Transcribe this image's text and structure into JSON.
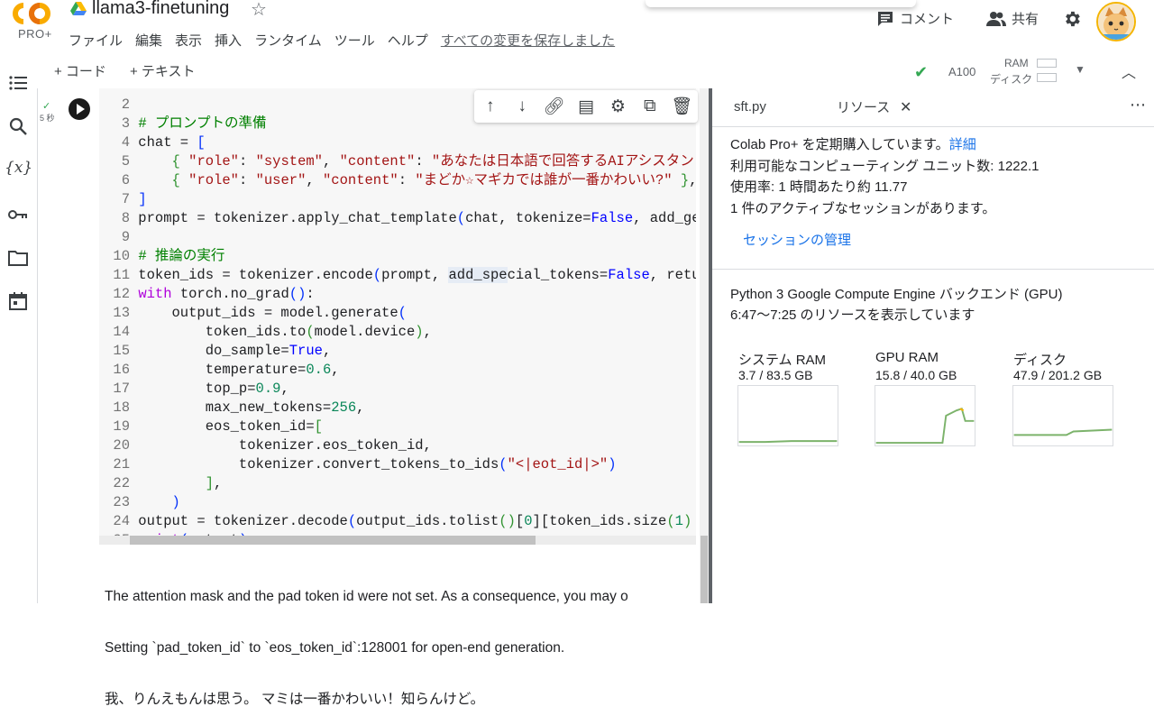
{
  "header": {
    "logo_sub": "PRO+",
    "title": "llama3-finetuning",
    "menu": [
      "ファイル",
      "編集",
      "表示",
      "挿入",
      "ランタイム",
      "ツール",
      "ヘルプ"
    ],
    "saved_status": "すべての変更を保存しました",
    "comment_label": "コメント",
    "share_label": "共有"
  },
  "toolbar": {
    "add_code": "+ コード",
    "add_text": "+ テキスト",
    "gpu": "A100",
    "ram_label": "RAM",
    "disk_label": "ディスク"
  },
  "cell": {
    "exec_time": "5 秒",
    "output_lines": [
      "The attention mask and the pad token id were not set. As a consequence, you may o",
      "Setting `pad_token_id` to `eos_token_id`:128001 for open-end generation.",
      "我、りんえもんは思う。 マミは一番かわいい！知らんけど。"
    ]
  },
  "panel": {
    "tab_file": "sft.py",
    "tab_resources": "リソース",
    "line1_prefix": "Colab Pro+ を定期購入しています。",
    "details_link": "詳細",
    "line2": "利用可能なコンピューティング ユニット数: 1222.1",
    "line3": "使用率: 1 時間あたり約 11.77",
    "line4": "1 件のアクティブなセッションがあります。",
    "manage_link": "セッションの管理",
    "backend": "Python 3 Google Compute Engine バックエンド (GPU)",
    "range": "6:47〜7:25 のリソースを表示しています",
    "resources": [
      {
        "title": "システム RAM",
        "value": "3.7 / 83.5 GB"
      },
      {
        "title": "GPU RAM",
        "value": "15.8 / 40.0 GB"
      },
      {
        "title": "ディスク",
        "value": "47.9 / 201.2 GB"
      }
    ]
  },
  "colors": {
    "accent_green": "#34a853",
    "link_blue": "#1a73e8",
    "colab_orange": "#f9ab00"
  }
}
